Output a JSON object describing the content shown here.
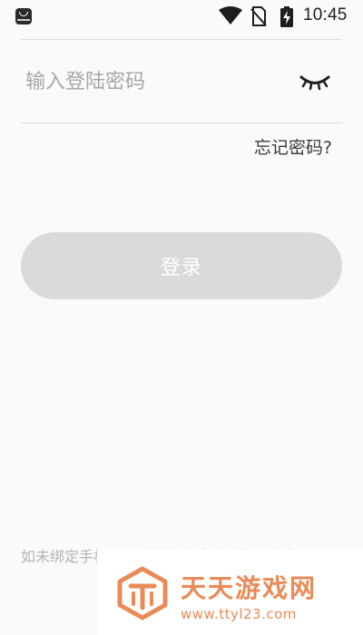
{
  "status_bar": {
    "time": "10:45",
    "icons": [
      "app-badge-icon",
      "wifi-icon",
      "sim-card-blocked-icon",
      "battery-charging-icon"
    ]
  },
  "form": {
    "password_placeholder": "输入登陆密码",
    "password_value": "",
    "toggle_icon": "eye-closed-icon",
    "forgot_password_label": "忘记密码?"
  },
  "actions": {
    "login_label": "登录"
  },
  "footer": {
    "note": "如未绑定手机号，系统会默认到手机号上来服"
  },
  "watermark": {
    "title": "天天游戏网",
    "url": "www.ttyl23.com",
    "color": "#ea8a57"
  },
  "colors": {
    "background": "#fafafa",
    "divider": "#dedede",
    "button_disabled": "#dadada",
    "placeholder": "#a7a7a7",
    "text": "#3a3a3a",
    "footer_text": "#b4b4b4"
  }
}
